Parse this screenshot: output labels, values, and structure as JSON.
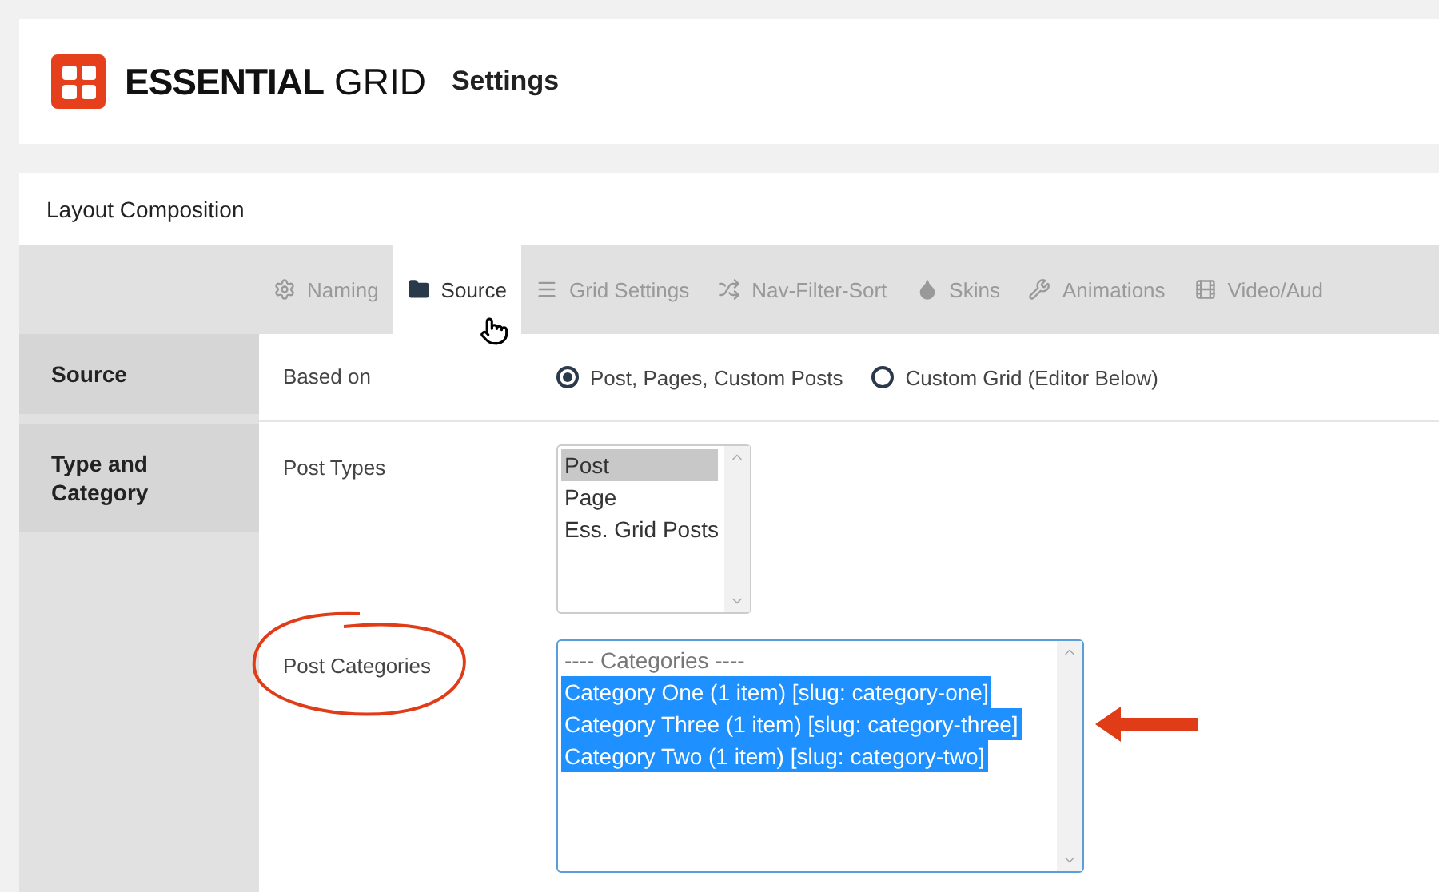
{
  "header": {
    "brand_bold": "ESSENTIAL",
    "brand_light": "GRID",
    "title": "Settings"
  },
  "panel": {
    "title": "Layout Composition"
  },
  "tabs": [
    {
      "label": "Naming",
      "selected": false
    },
    {
      "label": "Source",
      "selected": true
    },
    {
      "label": "Grid Settings",
      "selected": false
    },
    {
      "label": "Nav-Filter-Sort",
      "selected": false
    },
    {
      "label": "Skins",
      "selected": false
    },
    {
      "label": "Animations",
      "selected": false
    },
    {
      "label": "Video/Aud",
      "selected": false
    }
  ],
  "sidebar": {
    "items": [
      {
        "label": "Source"
      },
      {
        "label": "Type and Category"
      }
    ]
  },
  "based_on": {
    "label": "Based on",
    "options": [
      {
        "label": "Post, Pages, Custom Posts",
        "checked": true
      },
      {
        "label": "Custom Grid (Editor Below)",
        "checked": false
      }
    ]
  },
  "post_types": {
    "label": "Post Types",
    "options": [
      {
        "label": "Post",
        "selected": true
      },
      {
        "label": "Page",
        "selected": false
      },
      {
        "label": "Ess. Grid Posts",
        "selected": false
      }
    ]
  },
  "post_categories": {
    "label": "Post Categories",
    "options": [
      {
        "label": "---- Categories ----",
        "kind": "header",
        "selected": false
      },
      {
        "label": "Category One (1 item) [slug: category-one]",
        "kind": "option",
        "selected": true
      },
      {
        "label": "Category Three (1 item) [slug: category-three]",
        "kind": "option",
        "selected": true
      },
      {
        "label": "Category Two (1 item) [slug: category-two]",
        "kind": "option",
        "selected": true
      }
    ]
  }
}
